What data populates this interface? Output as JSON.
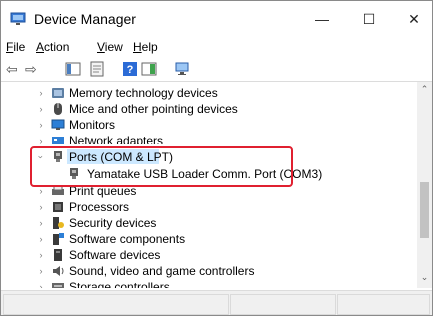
{
  "window": {
    "title": "Device Manager"
  },
  "controls": {
    "minimize": "—",
    "maximize": "☐",
    "close": "✕"
  },
  "menu": {
    "file": {
      "hot": "F",
      "rest": "ile"
    },
    "action": {
      "hot": "A",
      "rest": "ction"
    },
    "view": {
      "hot": "V",
      "rest": "iew"
    },
    "help": {
      "hot": "H",
      "rest": "elp"
    }
  },
  "toolbar": {
    "back": "⇦",
    "forward": "⇨"
  },
  "tree": {
    "memory": "Memory technology devices",
    "mice": "Mice and other pointing devices",
    "monitors": "Monitors",
    "network": "Network adapters",
    "ports": "Ports (COM & LPT)",
    "yamatake": "Yamatake USB Loader Comm. Port (COM3)",
    "print": "Print queues",
    "processors": "Processors",
    "security": "Security devices",
    "swcomp": "Software components",
    "swdev": "Software devices",
    "sound": "Sound, video and game controllers",
    "storage": "Storage controllers"
  },
  "colors": {
    "selection": "#cce8ff",
    "highlight_border": "#e02030"
  }
}
